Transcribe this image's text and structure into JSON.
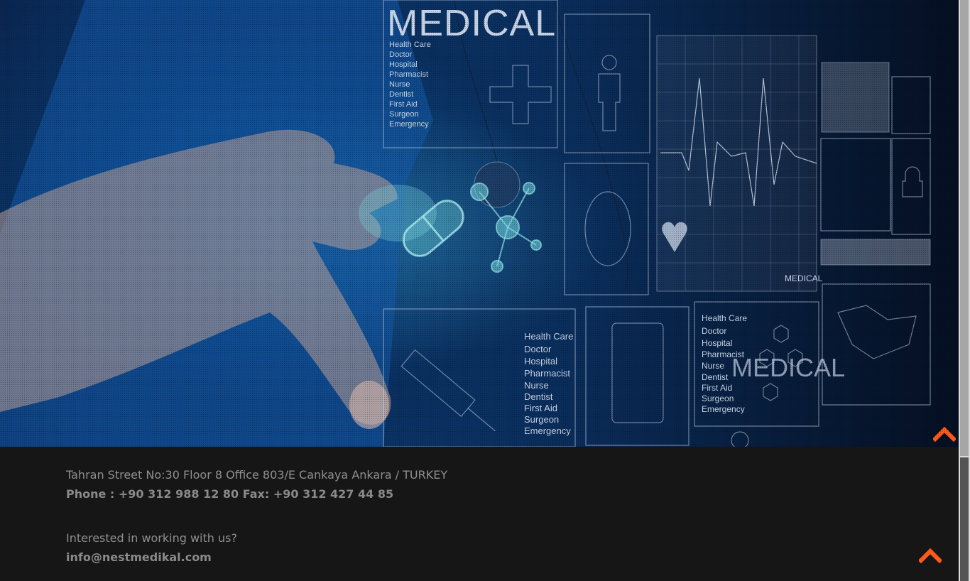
{
  "hero": {
    "background_image": "medical-technology-photo",
    "overlay_title": "MEDICAL",
    "overlay_title_small": "MEDICAL",
    "overlay_list": [
      "Health Care",
      "Doctor",
      "Hospital",
      "Pharmacist",
      "Nurse",
      "Dentist",
      "First Aid",
      "Surgeon",
      "Emergency"
    ]
  },
  "footer": {
    "address": "Tahran Street No:30 Floor 8 Office 803/E Cankaya Ankara / TURKEY",
    "phone_fax": "Phone : +90 312 988 12 80 Fax: +90 312 427 44 85",
    "career_prompt": "Interested in working with us?",
    "email": "info@nestmedikal.com"
  },
  "icons": {
    "back_to_top": "chevron-up-icon"
  },
  "colors": {
    "accent": "#ff5a1a",
    "footer_bg": "#161616",
    "footer_text": "#8f8f8f"
  }
}
